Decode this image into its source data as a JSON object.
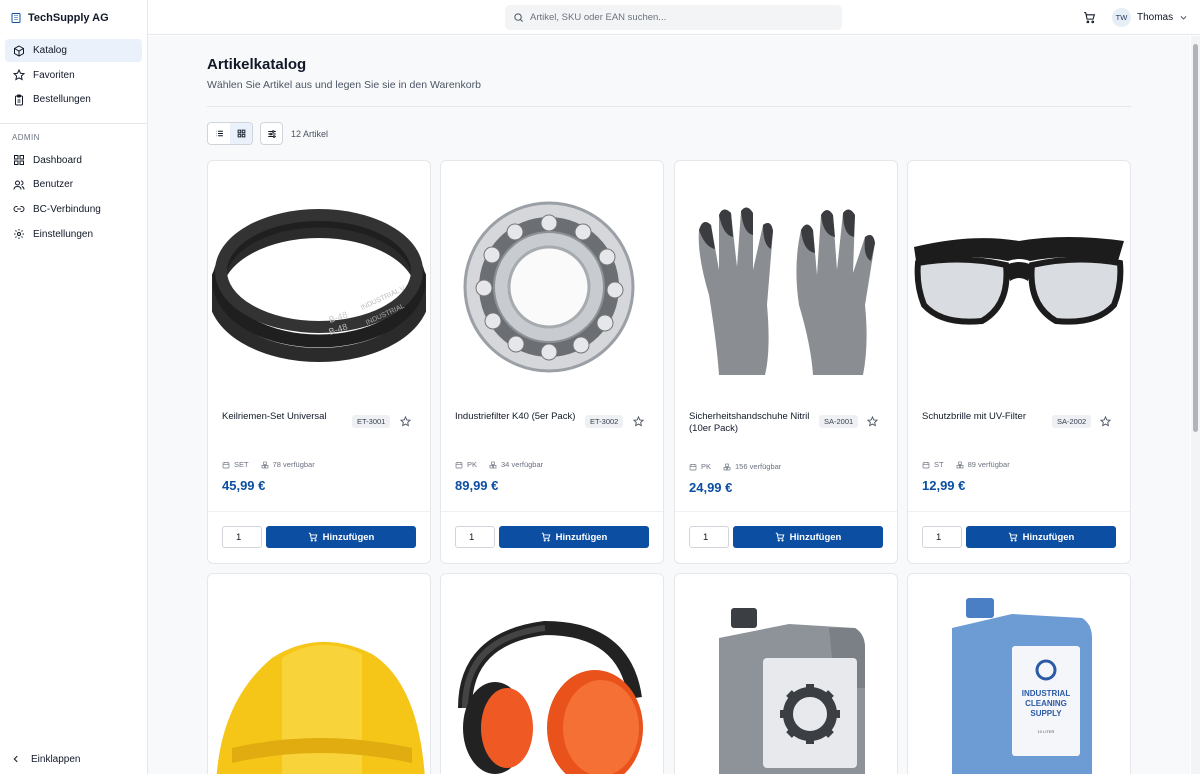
{
  "brand": {
    "name": "TechSupply AG",
    "icon": "building-icon"
  },
  "sidebar": {
    "items": [
      {
        "label": "Katalog",
        "icon": "box-icon",
        "active": true
      },
      {
        "label": "Favoriten",
        "icon": "star-icon"
      },
      {
        "label": "Bestellungen",
        "icon": "clipboard-icon"
      }
    ],
    "admin_title": "ADMIN",
    "admin_items": [
      {
        "label": "Dashboard",
        "icon": "dashboard-icon"
      },
      {
        "label": "Benutzer",
        "icon": "users-icon"
      },
      {
        "label": "BC-Verbindung",
        "icon": "link-icon"
      },
      {
        "label": "Einstellungen",
        "icon": "gear-icon"
      }
    ],
    "collapse_label": "Einklappen"
  },
  "topbar": {
    "search_placeholder": "Artikel, SKU oder EAN suchen...",
    "user": {
      "initials": "TW",
      "name": "Thomas"
    }
  },
  "page": {
    "title": "Artikelkatalog",
    "subtitle": "Wählen Sie Artikel aus und legen Sie sie in den Warenkorb",
    "count_label": "12 Artikel",
    "view_mode": "grid"
  },
  "colors": {
    "accent": "#0b4ea2",
    "active_nav": "#eaf1fb"
  },
  "products": [
    {
      "name": "Keilriemen-Set Universal",
      "sku": "ET-3001",
      "unit": "SET",
      "stock": "78 verfügbar",
      "price": "45,99 €",
      "qty": "1",
      "button": "Hinzufügen",
      "image": "v-belt-image"
    },
    {
      "name": "Industriefilter K40 (5er Pack)",
      "sku": "ET-3002",
      "unit": "PK",
      "stock": "34 verfügbar",
      "price": "89,99 €",
      "qty": "1",
      "button": "Hinzufügen",
      "image": "ball-bearing-image"
    },
    {
      "name": "Sicherheitshandschuhe Nitril (10er Pack)",
      "sku": "SA-2001",
      "unit": "PK",
      "stock": "156 verfügbar",
      "price": "24,99 €",
      "qty": "1",
      "button": "Hinzufügen",
      "image": "gloves-image"
    },
    {
      "name": "Schutzbrille mit UV-Filter",
      "sku": "SA-2002",
      "unit": "ST",
      "stock": "89 verfügbar",
      "price": "12,99 €",
      "qty": "1",
      "button": "Hinzufügen",
      "image": "safety-glasses-image"
    },
    {
      "image": "hard-hat-image"
    },
    {
      "image": "ear-muffs-image"
    },
    {
      "image": "oil-canister-image"
    },
    {
      "image": "cleaning-canister-image",
      "image_text": [
        "INDUSTRIAL",
        "CLEANING",
        "SUPPLY",
        "10 LITER"
      ]
    }
  ],
  "belt_text": [
    "B-48",
    "INDUSTRIAL V",
    "B-48",
    "INDUSTRIAL"
  ]
}
